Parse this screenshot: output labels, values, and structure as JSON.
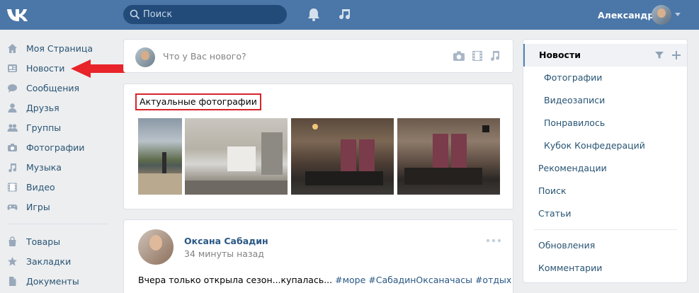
{
  "header": {
    "logo_icon": "vk-logo-icon",
    "search_placeholder": "Поиск",
    "user_name": "Александр"
  },
  "left_nav": {
    "items": [
      {
        "label": "Моя Страница",
        "icon": "home-icon"
      },
      {
        "label": "Новости",
        "icon": "news-icon"
      },
      {
        "label": "Сообщения",
        "icon": "messages-icon"
      },
      {
        "label": "Друзья",
        "icon": "person-icon"
      },
      {
        "label": "Группы",
        "icon": "groups-icon"
      },
      {
        "label": "Фотографии",
        "icon": "camera-icon"
      },
      {
        "label": "Музыка",
        "icon": "music-icon"
      },
      {
        "label": "Видео",
        "icon": "film-icon"
      },
      {
        "label": "Игры",
        "icon": "gamepad-icon"
      }
    ],
    "items2": [
      {
        "label": "Товары",
        "icon": "bag-icon"
      },
      {
        "label": "Закладки",
        "icon": "star-icon"
      },
      {
        "label": "Документы",
        "icon": "document-icon"
      }
    ]
  },
  "composer": {
    "placeholder": "Что у Вас нового?"
  },
  "photos": {
    "title": "Актуальные фотографии"
  },
  "post": {
    "author": "Оксана Сабадин",
    "time": "34 минуты назад",
    "text": "Вчера только открыла сезон...купалась...",
    "tags": "#море #СабадинОксаначасы #отдых"
  },
  "right_menu": {
    "active": "Новости",
    "sub": [
      "Фотографии",
      "Видеозаписи",
      "Понравилось",
      "Кубок Конфедераций"
    ],
    "main": [
      "Рекомендации",
      "Поиск",
      "Статьи"
    ],
    "bottom": [
      "Обновления",
      "Комментарии"
    ]
  },
  "colors": {
    "header": "#4a76a8",
    "link": "#2a5885",
    "highlight_box": "#d8242a",
    "arrow": "#e8232a"
  }
}
